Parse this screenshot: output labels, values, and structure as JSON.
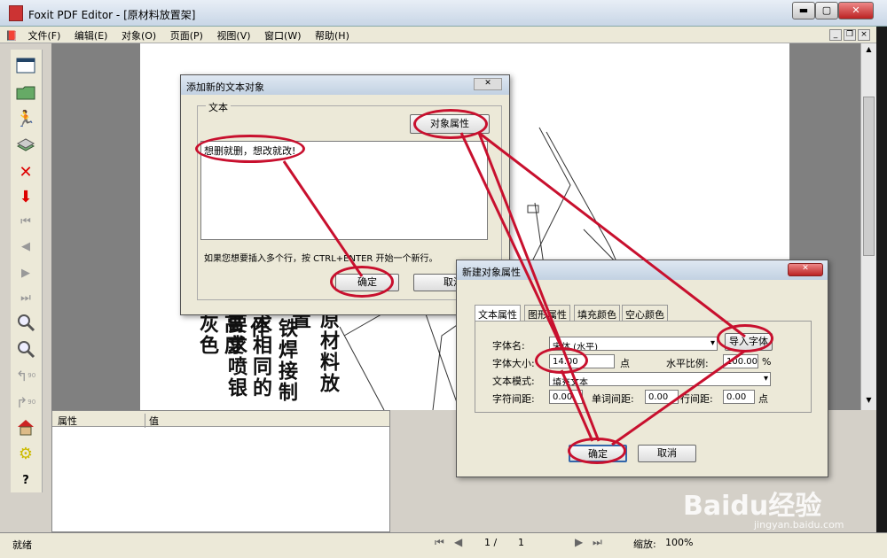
{
  "window": {
    "title": "Foxit PDF Editor - [原材料放置架]",
    "buttons": [
      "▬",
      "▢",
      "✕"
    ]
  },
  "menu": [
    "文件(F)",
    "编辑(E)",
    "对象(O)",
    "页面(P)",
    "视图(V)",
    "窗口(W)",
    "帮助(H)"
  ],
  "toolbar_icons": [
    "window-icon",
    "open-folder-icon",
    "runner-icon",
    "stack-icon",
    "delete-x-icon",
    "down-arrow-icon",
    "first-page-icon",
    "prev-page-icon",
    "next-page-icon",
    "last-page-icon",
    "zoom-in-icon",
    "zoom-out-icon",
    "rotate-left-icon",
    "rotate-right-icon",
    "house-icon",
    "gear-icon",
    "help-icon"
  ],
  "rotate_labels": [
    "90",
    "90"
  ],
  "help_glyph": "?",
  "page_texts": [
    "要求喷银灰色",
    "求相同的高度",
    "铁焊接制作",
    "原材料放置"
  ],
  "properties": {
    "col1": "属性",
    "col2": "值"
  },
  "status": {
    "ready": "就绪",
    "page_current": "1 /",
    "page_total": "1",
    "zoom_label": "缩放:",
    "zoom_value": "100%"
  },
  "dialog_add_text": {
    "title": "添加新的文本对象",
    "group_label": "文本",
    "props_button": "对象属性",
    "text_value": "想删就删，想改就改!",
    "hint": "如果您想要插入多个行，按 CTRL+ENTER 开始一个新行。",
    "ok": "确定",
    "cancel": "取消"
  },
  "dialog_props": {
    "title": "新建对象属性",
    "tabs": [
      "文本属性",
      "图形属性",
      "填充颜色",
      "空心颜色"
    ],
    "font_name_label": "字体名:",
    "font_name_value": "宋体 (水平)",
    "import_font": "导入字体",
    "font_size_label": "字体大小:",
    "font_size_value": "14.00",
    "font_size_unit": "点",
    "hscale_label": "水平比例:",
    "hscale_value": "100.00",
    "hscale_unit": "%",
    "mode_label": "文本模式:",
    "mode_value": "填充文本",
    "char_spacing_label": "字符间距:",
    "char_spacing_value": "0.00",
    "word_spacing_label": "单词间距:",
    "word_spacing_value": "0.00",
    "line_spacing_label": "行间距:",
    "line_spacing_value": "0.00",
    "line_spacing_unit": "点",
    "ok": "确定",
    "cancel": "取消"
  },
  "watermark": {
    "brand": "Baidu经验",
    "url": "jingyan.baidu.com"
  },
  "colors": {
    "annotation": "#c8102e"
  }
}
